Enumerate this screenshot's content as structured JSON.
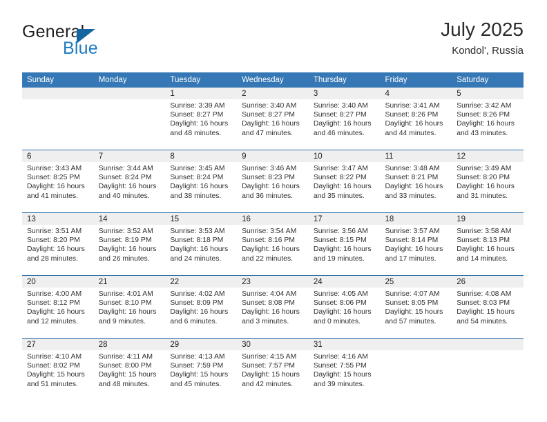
{
  "brand": {
    "word_general": "General",
    "word_blue": "Blue",
    "logo_icon": "triangle-logo-icon",
    "accent_color": "#15659f",
    "blue_text_color": "#1f7bc1"
  },
  "header": {
    "title": "July 2025",
    "subtitle": "Kondol', Russia"
  },
  "calendar": {
    "header_bg": "#3578b5",
    "header_text_color": "#ffffff",
    "row_separator_color": "#2b6ca8",
    "daynum_band_color": "#efefef",
    "weekday_headers": [
      "Sunday",
      "Monday",
      "Tuesday",
      "Wednesday",
      "Thursday",
      "Friday",
      "Saturday"
    ],
    "weeks": [
      [
        {
          "day": "",
          "blank": true,
          "sunrise": "",
          "sunset": "",
          "daylight_line1": "",
          "daylight_line2": ""
        },
        {
          "day": "",
          "blank": true,
          "sunrise": "",
          "sunset": "",
          "daylight_line1": "",
          "daylight_line2": ""
        },
        {
          "day": "1",
          "blank": false,
          "sunrise": "Sunrise: 3:39 AM",
          "sunset": "Sunset: 8:27 PM",
          "daylight_line1": "Daylight: 16 hours",
          "daylight_line2": "and 48 minutes."
        },
        {
          "day": "2",
          "blank": false,
          "sunrise": "Sunrise: 3:40 AM",
          "sunset": "Sunset: 8:27 PM",
          "daylight_line1": "Daylight: 16 hours",
          "daylight_line2": "and 47 minutes."
        },
        {
          "day": "3",
          "blank": false,
          "sunrise": "Sunrise: 3:40 AM",
          "sunset": "Sunset: 8:27 PM",
          "daylight_line1": "Daylight: 16 hours",
          "daylight_line2": "and 46 minutes."
        },
        {
          "day": "4",
          "blank": false,
          "sunrise": "Sunrise: 3:41 AM",
          "sunset": "Sunset: 8:26 PM",
          "daylight_line1": "Daylight: 16 hours",
          "daylight_line2": "and 44 minutes."
        },
        {
          "day": "5",
          "blank": false,
          "sunrise": "Sunrise: 3:42 AM",
          "sunset": "Sunset: 8:26 PM",
          "daylight_line1": "Daylight: 16 hours",
          "daylight_line2": "and 43 minutes."
        }
      ],
      [
        {
          "day": "6",
          "blank": false,
          "sunrise": "Sunrise: 3:43 AM",
          "sunset": "Sunset: 8:25 PM",
          "daylight_line1": "Daylight: 16 hours",
          "daylight_line2": "and 41 minutes."
        },
        {
          "day": "7",
          "blank": false,
          "sunrise": "Sunrise: 3:44 AM",
          "sunset": "Sunset: 8:24 PM",
          "daylight_line1": "Daylight: 16 hours",
          "daylight_line2": "and 40 minutes."
        },
        {
          "day": "8",
          "blank": false,
          "sunrise": "Sunrise: 3:45 AM",
          "sunset": "Sunset: 8:24 PM",
          "daylight_line1": "Daylight: 16 hours",
          "daylight_line2": "and 38 minutes."
        },
        {
          "day": "9",
          "blank": false,
          "sunrise": "Sunrise: 3:46 AM",
          "sunset": "Sunset: 8:23 PM",
          "daylight_line1": "Daylight: 16 hours",
          "daylight_line2": "and 36 minutes."
        },
        {
          "day": "10",
          "blank": false,
          "sunrise": "Sunrise: 3:47 AM",
          "sunset": "Sunset: 8:22 PM",
          "daylight_line1": "Daylight: 16 hours",
          "daylight_line2": "and 35 minutes."
        },
        {
          "day": "11",
          "blank": false,
          "sunrise": "Sunrise: 3:48 AM",
          "sunset": "Sunset: 8:21 PM",
          "daylight_line1": "Daylight: 16 hours",
          "daylight_line2": "and 33 minutes."
        },
        {
          "day": "12",
          "blank": false,
          "sunrise": "Sunrise: 3:49 AM",
          "sunset": "Sunset: 8:20 PM",
          "daylight_line1": "Daylight: 16 hours",
          "daylight_line2": "and 31 minutes."
        }
      ],
      [
        {
          "day": "13",
          "blank": false,
          "sunrise": "Sunrise: 3:51 AM",
          "sunset": "Sunset: 8:20 PM",
          "daylight_line1": "Daylight: 16 hours",
          "daylight_line2": "and 28 minutes."
        },
        {
          "day": "14",
          "blank": false,
          "sunrise": "Sunrise: 3:52 AM",
          "sunset": "Sunset: 8:19 PM",
          "daylight_line1": "Daylight: 16 hours",
          "daylight_line2": "and 26 minutes."
        },
        {
          "day": "15",
          "blank": false,
          "sunrise": "Sunrise: 3:53 AM",
          "sunset": "Sunset: 8:18 PM",
          "daylight_line1": "Daylight: 16 hours",
          "daylight_line2": "and 24 minutes."
        },
        {
          "day": "16",
          "blank": false,
          "sunrise": "Sunrise: 3:54 AM",
          "sunset": "Sunset: 8:16 PM",
          "daylight_line1": "Daylight: 16 hours",
          "daylight_line2": "and 22 minutes."
        },
        {
          "day": "17",
          "blank": false,
          "sunrise": "Sunrise: 3:56 AM",
          "sunset": "Sunset: 8:15 PM",
          "daylight_line1": "Daylight: 16 hours",
          "daylight_line2": "and 19 minutes."
        },
        {
          "day": "18",
          "blank": false,
          "sunrise": "Sunrise: 3:57 AM",
          "sunset": "Sunset: 8:14 PM",
          "daylight_line1": "Daylight: 16 hours",
          "daylight_line2": "and 17 minutes."
        },
        {
          "day": "19",
          "blank": false,
          "sunrise": "Sunrise: 3:58 AM",
          "sunset": "Sunset: 8:13 PM",
          "daylight_line1": "Daylight: 16 hours",
          "daylight_line2": "and 14 minutes."
        }
      ],
      [
        {
          "day": "20",
          "blank": false,
          "sunrise": "Sunrise: 4:00 AM",
          "sunset": "Sunset: 8:12 PM",
          "daylight_line1": "Daylight: 16 hours",
          "daylight_line2": "and 12 minutes."
        },
        {
          "day": "21",
          "blank": false,
          "sunrise": "Sunrise: 4:01 AM",
          "sunset": "Sunset: 8:10 PM",
          "daylight_line1": "Daylight: 16 hours",
          "daylight_line2": "and 9 minutes."
        },
        {
          "day": "22",
          "blank": false,
          "sunrise": "Sunrise: 4:02 AM",
          "sunset": "Sunset: 8:09 PM",
          "daylight_line1": "Daylight: 16 hours",
          "daylight_line2": "and 6 minutes."
        },
        {
          "day": "23",
          "blank": false,
          "sunrise": "Sunrise: 4:04 AM",
          "sunset": "Sunset: 8:08 PM",
          "daylight_line1": "Daylight: 16 hours",
          "daylight_line2": "and 3 minutes."
        },
        {
          "day": "24",
          "blank": false,
          "sunrise": "Sunrise: 4:05 AM",
          "sunset": "Sunset: 8:06 PM",
          "daylight_line1": "Daylight: 16 hours",
          "daylight_line2": "and 0 minutes."
        },
        {
          "day": "25",
          "blank": false,
          "sunrise": "Sunrise: 4:07 AM",
          "sunset": "Sunset: 8:05 PM",
          "daylight_line1": "Daylight: 15 hours",
          "daylight_line2": "and 57 minutes."
        },
        {
          "day": "26",
          "blank": false,
          "sunrise": "Sunrise: 4:08 AM",
          "sunset": "Sunset: 8:03 PM",
          "daylight_line1": "Daylight: 15 hours",
          "daylight_line2": "and 54 minutes."
        }
      ],
      [
        {
          "day": "27",
          "blank": false,
          "sunrise": "Sunrise: 4:10 AM",
          "sunset": "Sunset: 8:02 PM",
          "daylight_line1": "Daylight: 15 hours",
          "daylight_line2": "and 51 minutes."
        },
        {
          "day": "28",
          "blank": false,
          "sunrise": "Sunrise: 4:11 AM",
          "sunset": "Sunset: 8:00 PM",
          "daylight_line1": "Daylight: 15 hours",
          "daylight_line2": "and 48 minutes."
        },
        {
          "day": "29",
          "blank": false,
          "sunrise": "Sunrise: 4:13 AM",
          "sunset": "Sunset: 7:59 PM",
          "daylight_line1": "Daylight: 15 hours",
          "daylight_line2": "and 45 minutes."
        },
        {
          "day": "30",
          "blank": false,
          "sunrise": "Sunrise: 4:15 AM",
          "sunset": "Sunset: 7:57 PM",
          "daylight_line1": "Daylight: 15 hours",
          "daylight_line2": "and 42 minutes."
        },
        {
          "day": "31",
          "blank": false,
          "sunrise": "Sunrise: 4:16 AM",
          "sunset": "Sunset: 7:55 PM",
          "daylight_line1": "Daylight: 15 hours",
          "daylight_line2": "and 39 minutes."
        },
        {
          "day": "",
          "blank": true,
          "sunrise": "",
          "sunset": "",
          "daylight_line1": "",
          "daylight_line2": ""
        },
        {
          "day": "",
          "blank": true,
          "sunrise": "",
          "sunset": "",
          "daylight_line1": "",
          "daylight_line2": ""
        }
      ]
    ]
  }
}
